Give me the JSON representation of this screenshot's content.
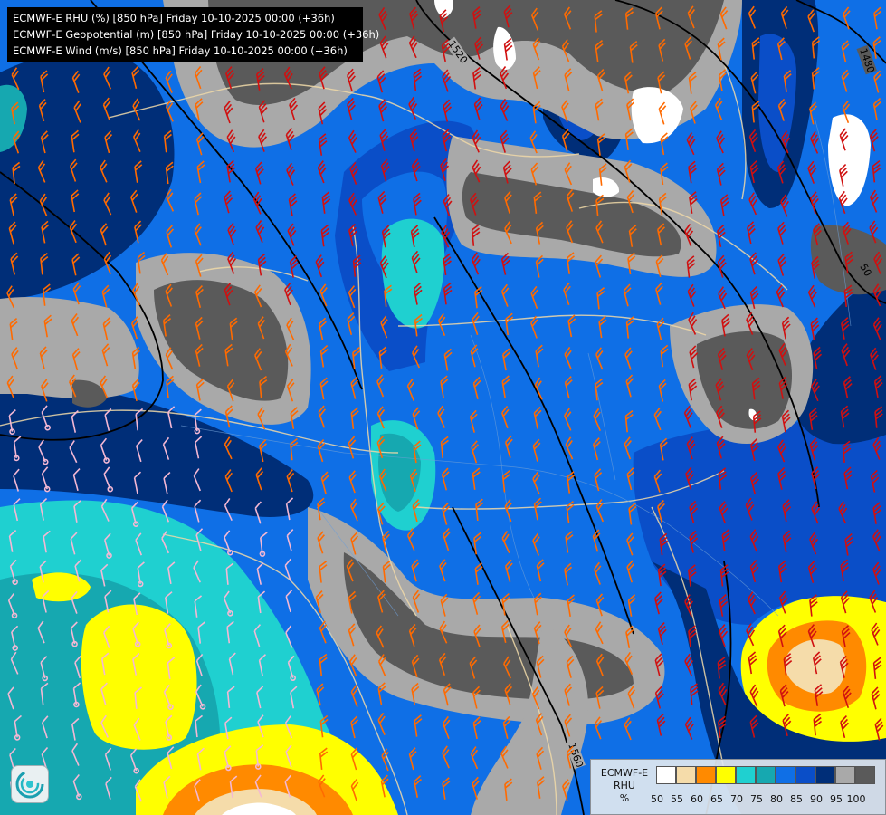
{
  "titles": [
    "ECMWF-E RHU (%) [850 hPa] Friday 10-10-2025 00:00 (+36h)",
    "ECMWF-E Geopotential (m) [850 hPa] Friday 10-10-2025 00:00 (+36h)",
    "ECMWF-E Wind (m/s) [850 hPa] Friday 10-10-2025 00:00 (+36h)"
  ],
  "legend": {
    "model": "ECMWF-E",
    "variable": "RHU",
    "unit": "%",
    "ticks": [
      "50",
      "55",
      "60",
      "65",
      "70",
      "75",
      "80",
      "85",
      "90",
      "95",
      "100"
    ],
    "colors": [
      "#ffffff",
      "#f5dcaa",
      "#ff8a00",
      "#ffff00",
      "#1fd0d0",
      "#16a8b0",
      "#0f6fe6",
      "#0a4ec8",
      "#002e78",
      "#a9a9a9",
      "#5a5a5a"
    ]
  },
  "contours": {
    "labels": [
      "1520",
      "1480",
      "1560",
      "50"
    ]
  },
  "wind_barb_colors": {
    "light": "#f4b8d4",
    "moderate": "#ff6a00",
    "strong": "#d01010"
  },
  "logo": "ecmwf-swirl-icon"
}
